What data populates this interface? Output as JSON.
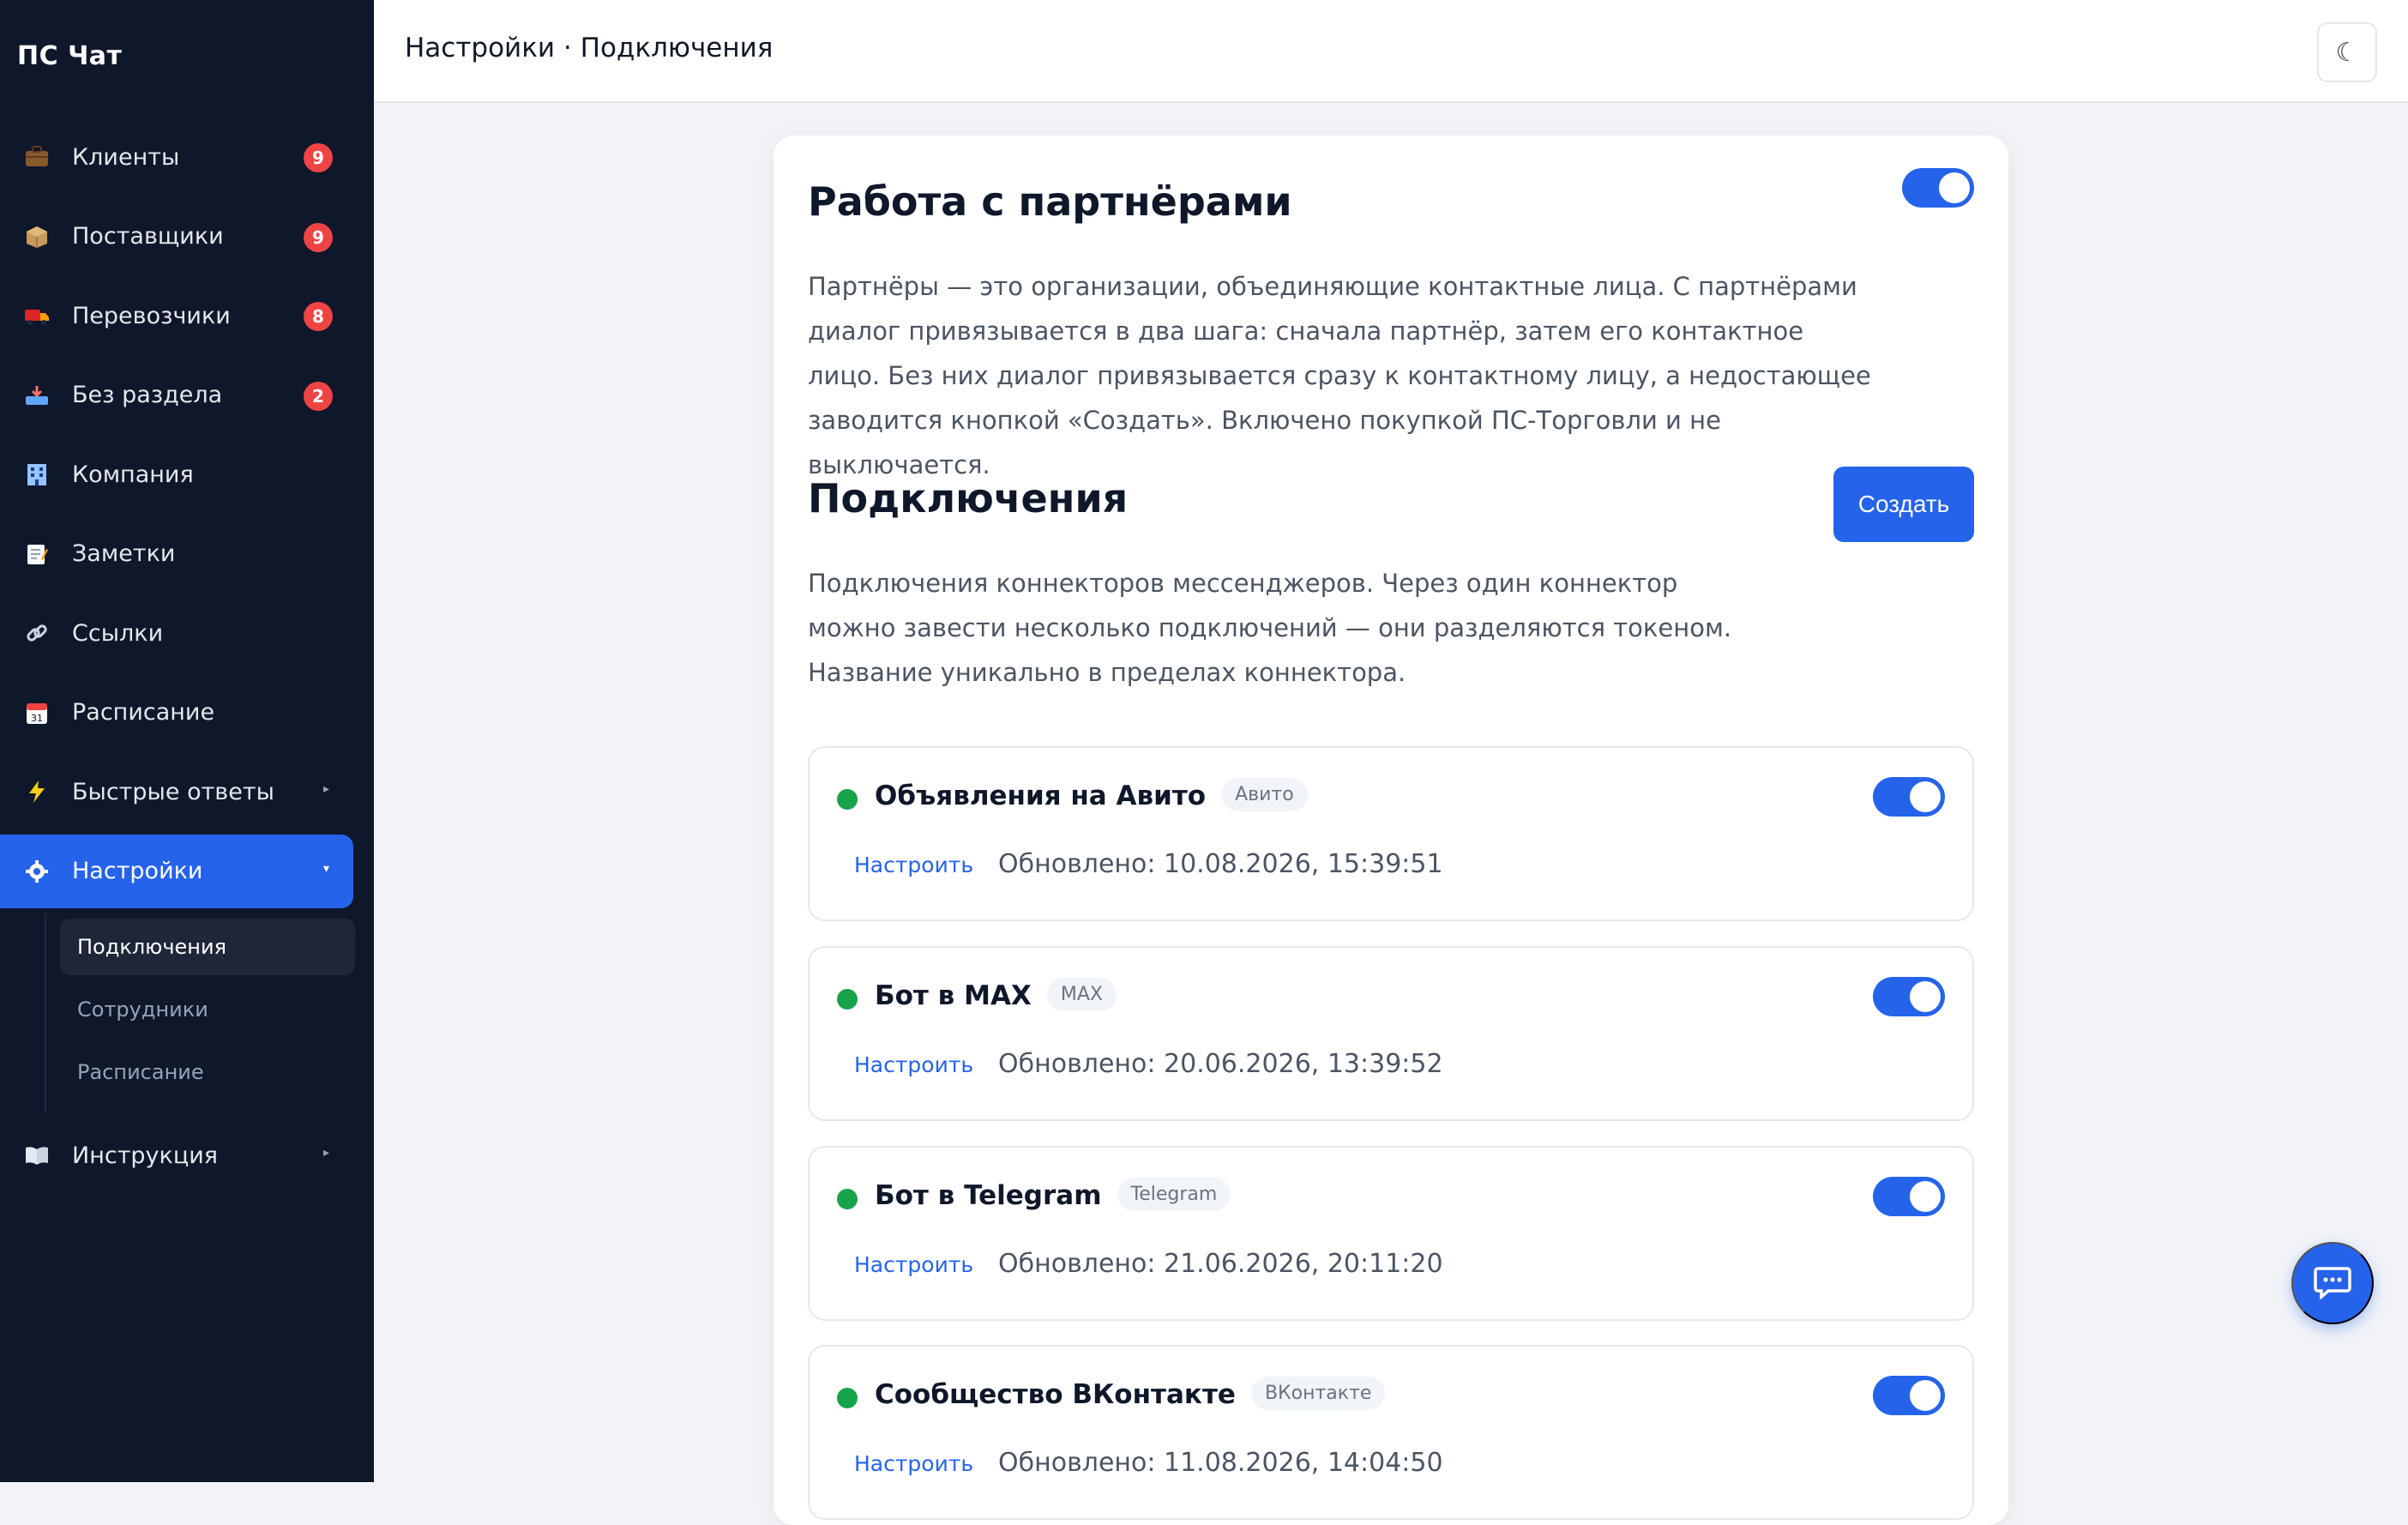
{
  "app": {
    "brand": "ПС Чат"
  },
  "header": {
    "title": "Настройки · Подключения",
    "theme_icon": "☾"
  },
  "sidebar": {
    "items": [
      {
        "label": "Клиенты",
        "icon": "briefcase-icon",
        "badge": "9"
      },
      {
        "label": "Поставщики",
        "icon": "box-icon",
        "badge": "9"
      },
      {
        "label": "Перевозчики",
        "icon": "truck-icon",
        "badge": "8"
      },
      {
        "label": "Без раздела",
        "icon": "inbox-tray-icon",
        "badge": "2"
      },
      {
        "label": "Компания",
        "icon": "office-building-icon"
      },
      {
        "label": "Заметки",
        "icon": "memo-icon"
      },
      {
        "label": "Ссылки",
        "icon": "link-icon"
      },
      {
        "label": "Расписание",
        "icon": "calendar-icon"
      },
      {
        "label": "Быстрые ответы",
        "icon": "lightning-icon"
      },
      {
        "label": "Настройки",
        "icon": "gear-icon",
        "active": true
      },
      {
        "label": "Инструкция",
        "icon": "book-icon"
      }
    ],
    "settings_sub": [
      {
        "label": "Подключения",
        "active": true
      },
      {
        "label": "Сотрудники"
      },
      {
        "label": "Расписание"
      }
    ]
  },
  "partners": {
    "title": "Работа с партнёрами",
    "enabled": true,
    "description": "Партнёры — это организации, объединяющие контактные лица. С партнёрами диалог привязывается в два шага: сначала партнёр, затем его контактное лицо. Без них диалог привязывается сразу к контактному лицу, а недостающее заводится кнопкой «Создать». Включено покупкой ПС-Торговли и не выключается."
  },
  "connections": {
    "title": "Подключения",
    "create_label": "Создать",
    "description": "Подключения коннекторов мессенджеров. Через один коннектор можно завести несколько подключений — они разделяются токеном. Название уникально в пределах коннектора.",
    "configure_label": "Настроить",
    "items": [
      {
        "name": "Объявления на Авито",
        "tag": "Авито",
        "updated": "Обновлено: 10.08.2026, 15:39:51",
        "enabled": true,
        "status_color": "#16a34a"
      },
      {
        "name": "Бот в MAX",
        "tag": "MAX",
        "updated": "Обновлено: 20.06.2026, 13:39:52",
        "enabled": true,
        "status_color": "#16a34a"
      },
      {
        "name": "Бот в Telegram",
        "tag": "Telegram",
        "updated": "Обновлено: 21.06.2026, 20:11:20",
        "enabled": true,
        "status_color": "#16a34a"
      },
      {
        "name": "Сообщество ВКонтакте",
        "tag": "ВКонтакте",
        "updated": "Обновлено: 11.08.2026, 14:04:50",
        "enabled": true,
        "status_color": "#16a34a"
      }
    ]
  },
  "colors": {
    "accent": "#2563eb",
    "sidebar_bg": "#0f172a",
    "badge": "#ef4444",
    "status_online": "#16a34a"
  }
}
